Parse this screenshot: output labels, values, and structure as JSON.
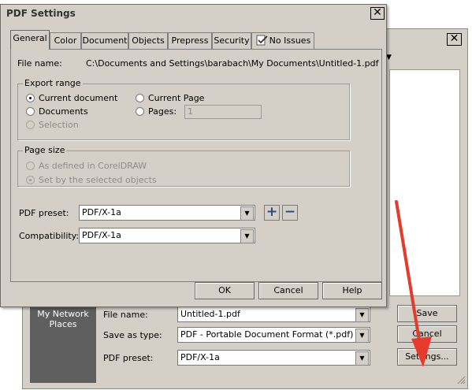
{
  "save_dialog": {
    "close_glyph": "✕",
    "places_label": "My Network Places",
    "file_name_label": "File name:",
    "file_name_value": "Untitled-1.pdf",
    "save_type_label": "Save as type:",
    "save_type_value": "PDF - Portable Document Format (*.pdf)",
    "preset_label": "PDF preset:",
    "preset_value": "PDF/X-1a",
    "save_button": "Save",
    "cancel_button": "Cancel",
    "settings_button": "Settings..."
  },
  "pdf_dialog": {
    "title": "PDF Settings",
    "close_glyph": "✕",
    "tabs": [
      "General",
      "Color",
      "Document",
      "Objects",
      "Prepress",
      "Security",
      "No Issues"
    ],
    "file_name_label": "File name:",
    "file_name_value": "C:\\Documents and Settings\\barabach\\My Documents\\Untitled-1.pdf",
    "export_range": {
      "title": "Export range",
      "current_document": "Current document",
      "documents": "Documents",
      "selection": "Selection",
      "current_page": "Current Page",
      "pages": "Pages:",
      "pages_value": "1"
    },
    "page_size": {
      "title": "Page size",
      "as_defined": "As defined in CorelDRAW",
      "set_by_selected": "Set by the selected objects"
    },
    "preset_label": "PDF preset:",
    "preset_value": "PDF/X-1a",
    "compat_label": "Compatibility:",
    "compat_value": "PDF/X-1a",
    "ok_button": "OK",
    "cancel_button": "Cancel",
    "help_button": "Help"
  },
  "colors": {
    "annotation_arrow": "#e53b2c",
    "dialog_face": "#d4d0c8"
  }
}
